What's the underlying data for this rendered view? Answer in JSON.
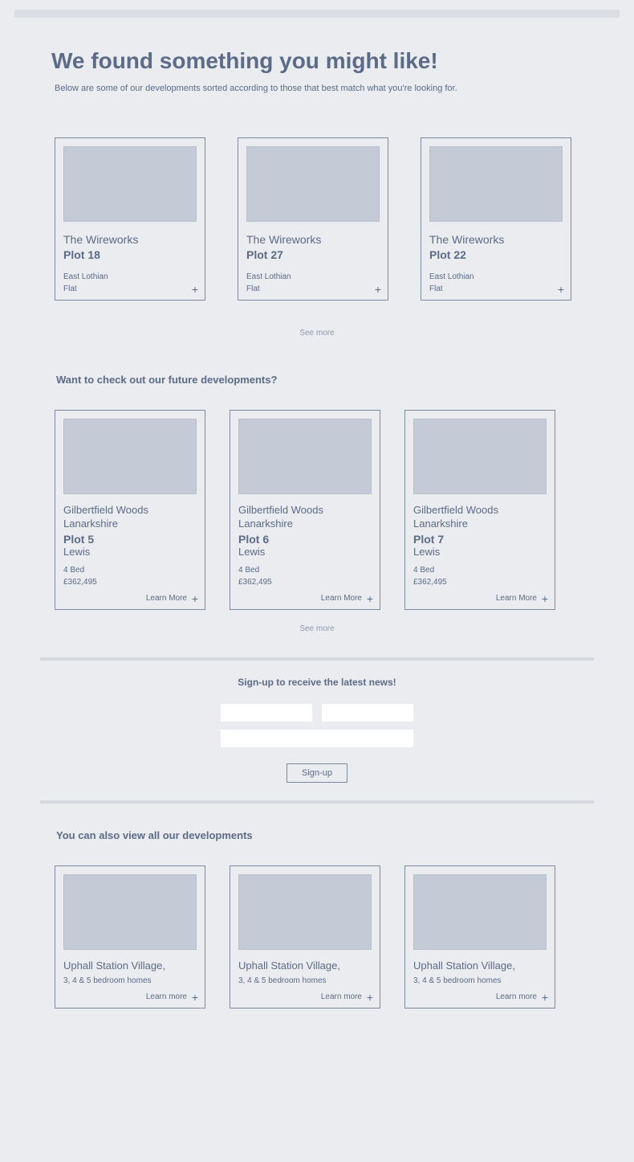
{
  "header": {
    "title": "We found something you might like!",
    "subtitle": "Below are some of our developments sorted according to those that best match what you're looking for."
  },
  "matches": [
    {
      "name": "The Wireworks",
      "plot": "Plot 18",
      "region": "East Lothian",
      "type": "Flat"
    },
    {
      "name": "The Wireworks",
      "plot": "Plot 27",
      "region": "East Lothian",
      "type": "Flat"
    },
    {
      "name": "The Wireworks",
      "plot": "Plot 22",
      "region": "East Lothian",
      "type": "Flat"
    }
  ],
  "matches_see_more": "See more",
  "future_heading": "Want to check out our future developments?",
  "future": [
    {
      "name": "Gilbertfield Woods",
      "loc": "Lanarkshire",
      "plot": "Plot 5",
      "sub": "Lewis",
      "beds": "4 Bed",
      "price": "£362,495",
      "learn": "Learn More"
    },
    {
      "name": "Gilbertfield Woods",
      "loc": "Lanarkshire",
      "plot": "Plot 6",
      "sub": "Lewis",
      "beds": "4 Bed",
      "price": "£362,495",
      "learn": "Learn More"
    },
    {
      "name": "Gilbertfield Woods",
      "loc": "Lanarkshire",
      "plot": "Plot 7",
      "sub": "Lewis",
      "beds": "4 Bed",
      "price": "£362,495",
      "learn": "Learn More"
    }
  ],
  "future_see_more": "See more",
  "signup": {
    "heading": "Sign-up to receive the latest news!",
    "button": "Sign-up"
  },
  "all_heading": "You can also view all our developments",
  "all": [
    {
      "name": "Uphall Station Village,",
      "desc": "3, 4 & 5 bedroom homes",
      "learn": "Learn more"
    },
    {
      "name": "Uphall Station Village,",
      "desc": "3, 4 & 5 bedroom homes",
      "learn": "Learn more"
    },
    {
      "name": "Uphall Station Village,",
      "desc": "3, 4 & 5 bedroom homes",
      "learn": "Learn more"
    }
  ]
}
